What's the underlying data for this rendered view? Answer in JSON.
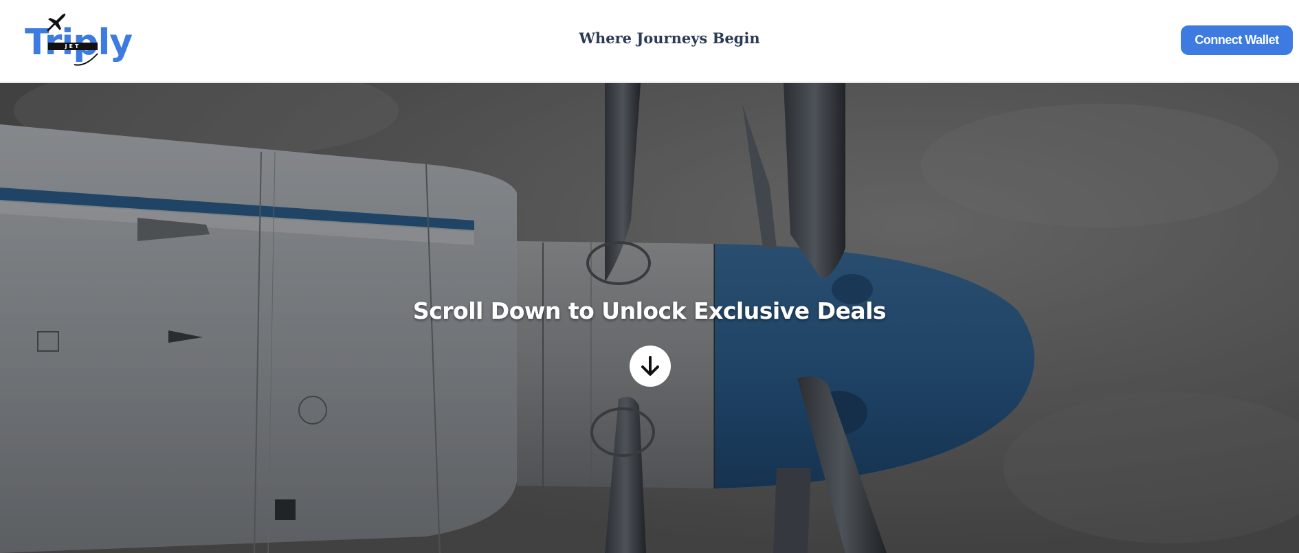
{
  "header": {
    "logo": {
      "text": "Triply",
      "badge": "JET"
    },
    "tagline": "Where Journeys Begin",
    "connect_label": "Connect Wallet"
  },
  "hero": {
    "title": "Scroll Down to Unlock Exclusive Deals",
    "scroll_icon": "arrow-down-icon"
  },
  "colors": {
    "brand_blue": "#3d7be0",
    "tagline": "#2b3a55",
    "engine_blue": "#2c5f8e"
  }
}
